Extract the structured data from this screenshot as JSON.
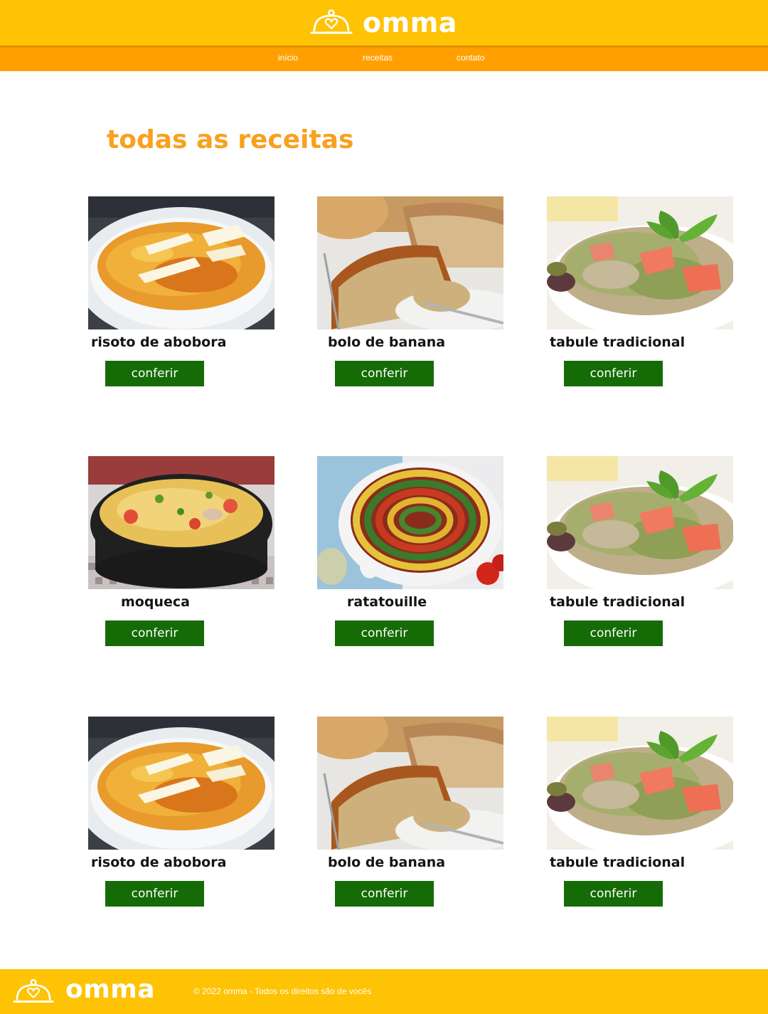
{
  "header": {
    "brand": "omma",
    "nav": [
      {
        "label": "início"
      },
      {
        "label": "receitas"
      },
      {
        "label": "contato"
      }
    ]
  },
  "main": {
    "title": "todas as receitas",
    "recipes": [
      {
        "name": "risoto de abobora",
        "button": "conferir",
        "photo": "risoto"
      },
      {
        "name": "bolo de banana",
        "button": "conferir",
        "photo": "bolo"
      },
      {
        "name": "tabule tradicional",
        "button": "conferir",
        "photo": "tabule"
      },
      {
        "name": "moqueca",
        "button": "conferir",
        "photo": "moqueca"
      },
      {
        "name": "ratatouille",
        "button": "conferir",
        "photo": "ratatouille"
      },
      {
        "name": "tabule tradicional",
        "button": "conferir",
        "photo": "tabule"
      },
      {
        "name": "risoto de abobora",
        "button": "conferir",
        "photo": "risoto"
      },
      {
        "name": "bolo de banana",
        "button": "conferir",
        "photo": "bolo"
      },
      {
        "name": "tabule tradicional",
        "button": "conferir",
        "photo": "tabule"
      }
    ]
  },
  "footer": {
    "brand": "omma",
    "copyright": "© 2022 omma - Todos os direitos são de vocês"
  },
  "colors": {
    "header": "#fec304",
    "nav": "#ffa000",
    "title": "#f8a11e",
    "button": "#156b05"
  }
}
